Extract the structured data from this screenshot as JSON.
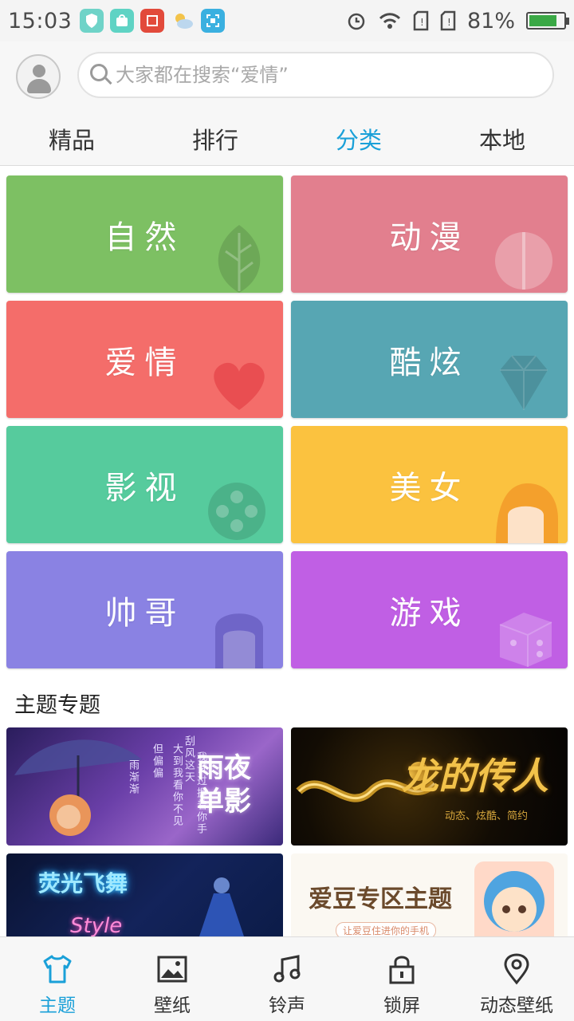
{
  "status_bar": {
    "time": "15:03",
    "battery_percent": "81%",
    "battery_level": 0.81,
    "apps": [
      {
        "icon": "shield-app-icon",
        "color": "#6fd3c8"
      },
      {
        "icon": "bag-app-icon",
        "color": "#5fd3c4"
      },
      {
        "icon": "stamp-app-icon",
        "color": "#e24a3b"
      },
      {
        "icon": "weather-app-icon",
        "color": "#f0c040"
      },
      {
        "icon": "scan-app-icon",
        "color": "#3ab0e0"
      }
    ]
  },
  "header": {
    "search_placeholder": "大家都在搜索“爱情”",
    "tabs": [
      {
        "label": "精品",
        "active": false
      },
      {
        "label": "排行",
        "active": false
      },
      {
        "label": "分类",
        "active": true
      },
      {
        "label": "本地",
        "active": false
      }
    ]
  },
  "categories": [
    {
      "label": "自然",
      "color": "#7dc063",
      "icon": "leaf-icon"
    },
    {
      "label": "动漫",
      "color": "#e27f8e",
      "icon": "apple-icon"
    },
    {
      "label": "爱情",
      "color": "#f46d6a",
      "icon": "heart-icon"
    },
    {
      "label": "酷炫",
      "color": "#57a6b3",
      "icon": "diamond-icon"
    },
    {
      "label": "影视",
      "color": "#56cb9d",
      "icon": "film-reel-icon"
    },
    {
      "label": "美女",
      "color": "#fbc23f",
      "icon": "girl-icon"
    },
    {
      "label": "帅哥",
      "color": "#8a82e3",
      "icon": "boy-icon"
    },
    {
      "label": "游戏",
      "color": "#c05fe4",
      "icon": "dice-icon"
    }
  ],
  "topics_section": {
    "title": "主题专题",
    "items": [
      {
        "title_line1": "雨夜",
        "title_line2": "单影",
        "verse1": "刮风这天",
        "verse2": "我试过握着你手",
        "verse3": "但偏偏",
        "verse4": "雨渐渐",
        "verse5": "大到我看你不见"
      },
      {
        "title": "龙的传人",
        "subtitle": "动态、炫酷、简约"
      },
      {
        "title_line1": "荧光飞舞",
        "title_line2": "Style"
      },
      {
        "title": "爱豆专区主题",
        "subtitle": "让爱豆住进你的手机"
      }
    ]
  },
  "bottom_nav": [
    {
      "label": "主题",
      "icon": "tshirt-icon",
      "active": true
    },
    {
      "label": "壁纸",
      "icon": "image-icon",
      "active": false
    },
    {
      "label": "铃声",
      "icon": "music-note-icon",
      "active": false
    },
    {
      "label": "锁屏",
      "icon": "lock-icon",
      "active": false
    },
    {
      "label": "动态壁纸",
      "icon": "location-pin-icon",
      "active": false
    }
  ]
}
